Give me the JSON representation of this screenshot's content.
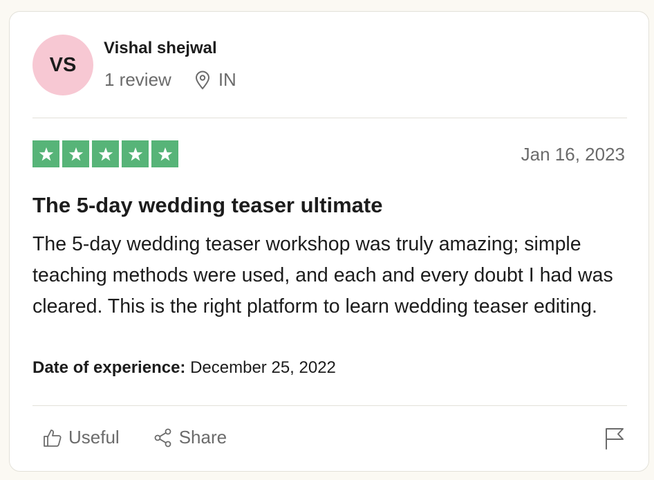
{
  "reviewer": {
    "initials": "VS",
    "name": "Vishal shejwal",
    "review_count": "1 review",
    "location": "IN",
    "avatar_color": "#f7c8d3"
  },
  "review": {
    "rating": 5,
    "rating_max": 5,
    "star_color": "#57b478",
    "date": "Jan 16, 2023",
    "title": "The 5-day wedding teaser ultimate",
    "body": "The 5-day wedding teaser workshop was truly amazing; simple teaching methods were used, and each and every doubt I had was cleared. This is the right platform to learn wedding teaser editing.",
    "experience_label": "Date of experience:",
    "experience_date": "December 25, 2022"
  },
  "actions": {
    "useful_label": "Useful",
    "share_label": "Share",
    "icons": [
      "thumbs-up-icon",
      "share-icon",
      "flag-icon",
      "location-pin-icon"
    ]
  }
}
